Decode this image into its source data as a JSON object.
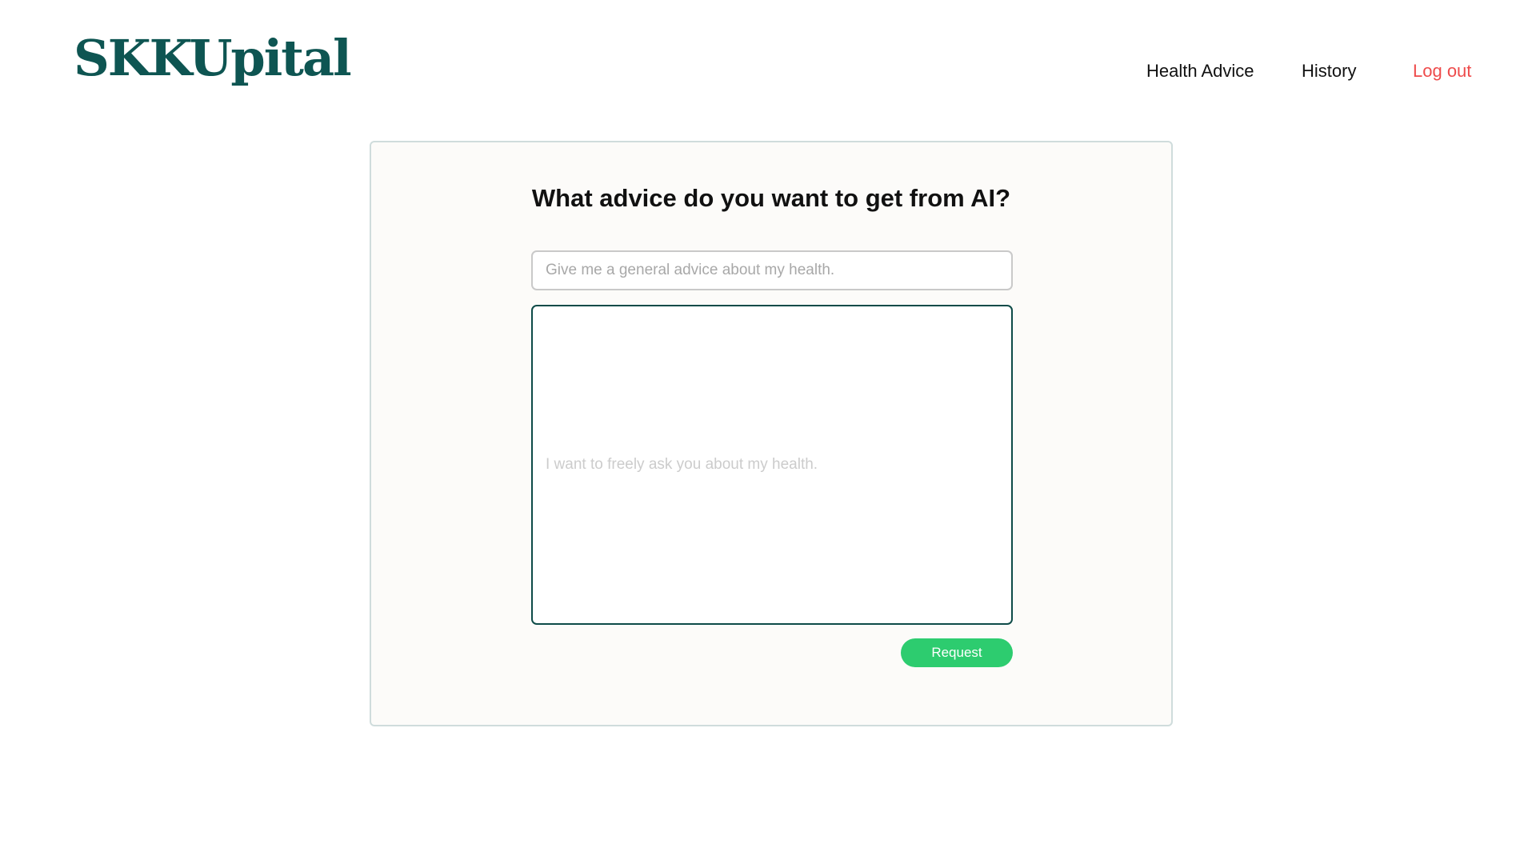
{
  "header": {
    "logo": "SKKUpital",
    "nav": {
      "health_advice": "Health Advice",
      "history": "History",
      "logout": "Log out"
    }
  },
  "main": {
    "title": "What advice do you want to get from AI?",
    "topic_input": {
      "placeholder": "Give me a general advice about my health.",
      "value": ""
    },
    "question_textarea": {
      "placeholder": "I want to freely ask you about my health."
    },
    "request_button_label": "Request"
  },
  "colors": {
    "brand": "#0e5552",
    "logout": "#ee4b4b",
    "request_button": "#2dcc6f",
    "card_background": "#fcfbf9",
    "textarea_border": "#0e4b48"
  }
}
